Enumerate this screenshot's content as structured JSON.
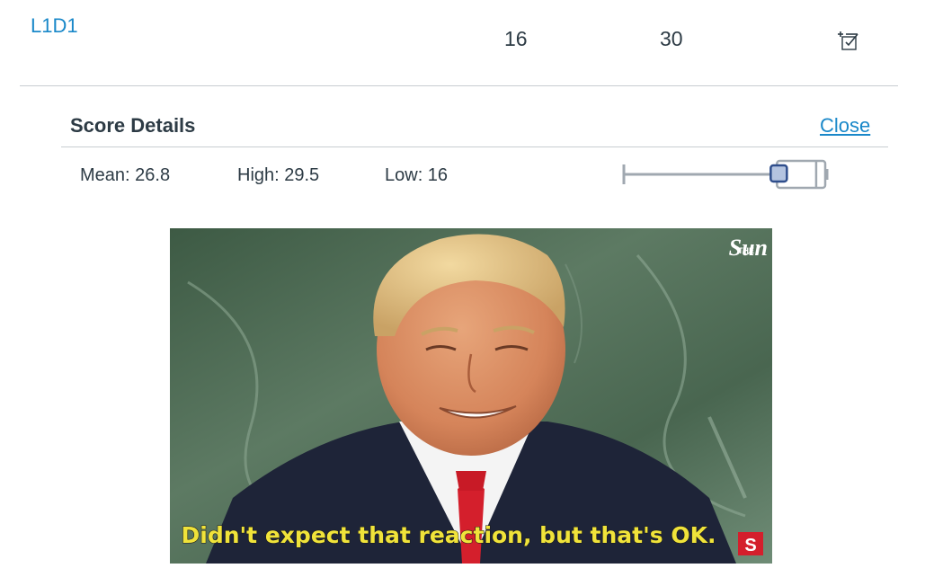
{
  "assignment": {
    "name": "L1D1",
    "score": "16",
    "points_possible": "30"
  },
  "score_details": {
    "title": "Score Details",
    "close_label": "Close",
    "mean_label": "Mean: 26.8",
    "high_label": "High: 29.5",
    "low_label": "Low: 16",
    "stats": {
      "mean": 26.8,
      "high": 29.5,
      "low": 16,
      "score": 16,
      "max": 30
    }
  },
  "image": {
    "caption": "Didn't expect that reaction, but that's OK.",
    "watermark": "Sun",
    "watermark_small": "THE",
    "corner_badge": "S"
  },
  "colors": {
    "link": "#1a88c9",
    "text": "#2d3b45",
    "divider": "#c7cdd1",
    "marker_fill": "#b4c4e0",
    "marker_stroke": "#2f4e8c",
    "caption": "#f0e33a"
  },
  "icons": {
    "score_details": "score-details-icon"
  }
}
